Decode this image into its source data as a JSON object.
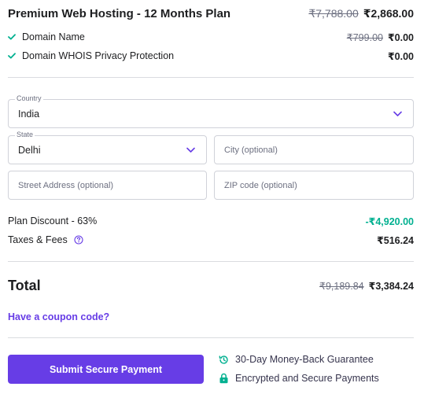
{
  "plan": {
    "title": "Premium Web Hosting - 12 Months Plan",
    "old_price": "₹7,788.00",
    "price": "₹2,868.00"
  },
  "features": [
    {
      "label": "Domain Name",
      "old_price": "₹799.00",
      "price": "₹0.00"
    },
    {
      "label": "Domain WHOIS Privacy Protection",
      "price": "₹0.00"
    }
  ],
  "form": {
    "country": {
      "label": "Country",
      "value": "India"
    },
    "state": {
      "label": "State",
      "value": "Delhi"
    },
    "city": {
      "placeholder": "City (optional)"
    },
    "street": {
      "placeholder": "Street Address (optional)"
    },
    "zip": {
      "placeholder": "ZIP code (optional)"
    }
  },
  "summary": {
    "discount_label": "Plan Discount - 63%",
    "discount_value": "-₹4,920.00",
    "taxes_label": "Taxes & Fees",
    "taxes_value": "₹516.24"
  },
  "total": {
    "label": "Total",
    "old_price": "₹9,189.84",
    "price": "₹3,384.24"
  },
  "coupon_link": "Have a coupon code?",
  "pay_button": "Submit Secure Payment",
  "guarantees": [
    {
      "icon": "history-icon",
      "label": "30-Day Money-Back Guarantee"
    },
    {
      "icon": "lock-icon",
      "label": "Encrypted and Secure Payments"
    }
  ],
  "colors": {
    "accent": "#673de6",
    "success": "#00b090",
    "text": "#1d1e20",
    "muted": "#6d7081"
  }
}
